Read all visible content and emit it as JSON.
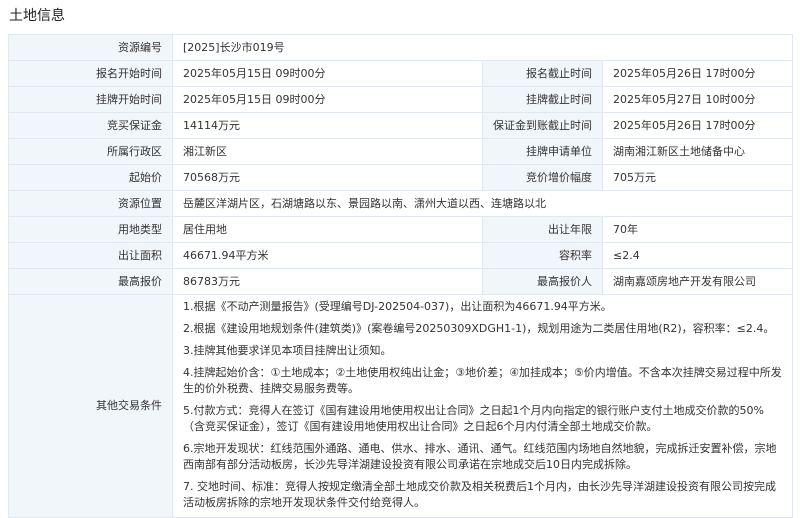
{
  "page": {
    "section_title": "土地信息"
  },
  "rows": [
    {
      "type": "wide",
      "label": "资源编号",
      "value": "[2025]长沙市019号"
    },
    {
      "type": "pair",
      "label1": "报名开始时间",
      "value1": "2025年05月15日 09时00分",
      "label2": "报名截止时间",
      "value2": "2025年05月26日 17时00分"
    },
    {
      "type": "pair",
      "label1": "挂牌开始时间",
      "value1": "2025年05月15日 09时00分",
      "label2": "挂牌截止时间",
      "value2": "2025年05月27日 10时00分"
    },
    {
      "type": "pair",
      "label1": "竞买保证金",
      "value1": "14114万元",
      "label2": "保证金到账截止时间",
      "value2": "2025年05月26日 17时00分"
    },
    {
      "type": "pair",
      "label1": "所属行政区",
      "value1": "湘江新区",
      "label2": "挂牌申请单位",
      "value2": "湖南湘江新区土地储备中心"
    },
    {
      "type": "pair",
      "label1": "起始价",
      "value1": "70568万元",
      "label2": "竞价增价幅度",
      "value2": "705万元"
    },
    {
      "type": "wide",
      "label": "资源位置",
      "value": "岳麓区洋湖片区，石湖塘路以东、景园路以南、潇州大道以西、连塘路以北"
    },
    {
      "type": "pair",
      "label1": "用地类型",
      "value1": "居住用地",
      "label2": "出让年限",
      "value2": "70年"
    },
    {
      "type": "pair",
      "label1": "出让面积",
      "value1": "46671.94平方米",
      "label2": "容积率",
      "value2": "≤2.4"
    },
    {
      "type": "pair",
      "label1": "最高报价",
      "value1": "86783万元",
      "label2": "最高报价人",
      "value2": "湖南嘉颂房地产开发有限公司"
    }
  ],
  "conditions": {
    "label": "其他交易条件",
    "items": [
      "1.根据《不动产测量报告》(受理编号DJ-202504-037)，出让面积为46671.94平方米。",
      "2.根据《建设用地规划条件(建筑类)》(案卷编号20250309XDGH1-1)，规划用途为二类居住用地(R2)，容积率：≤2.4。",
      "3.挂牌其他要求详见本项目挂牌出让须知。",
      "4.挂牌起始价含：①土地成本；②土地使用权纯出让金；③地价差；④加挂成本；⑤价内增值。不含本次挂牌交易过程中所发生的价外税费、挂牌交易服务费等。",
      "5.付款方式：竞得人在签订《国有建设用地使用权出让合同》之日起1个月内向指定的银行账户支付土地成交价款的50%（含竞买保证金），签订《国有建设用地使用权出让合同》之日起6个月内付清全部土地成交价款。",
      "6.宗地开发现状：红线范围外通路、通电、供水、排水、通讯、通气。红线范围内场地自然地貌，完成拆迁安置补偿，宗地西南部有部分活动板房，长沙先导洋湖建设投资有限公司承诺在宗地成交后10日内完成拆除。",
      "7. 交地时间、标准：竞得人按规定缴清全部土地成交价款及相关税费后1个月内，由长沙先导洋湖建设投资有限公司按完成活动板房拆除的宗地开发现状条件交付给竞得人。"
    ]
  }
}
